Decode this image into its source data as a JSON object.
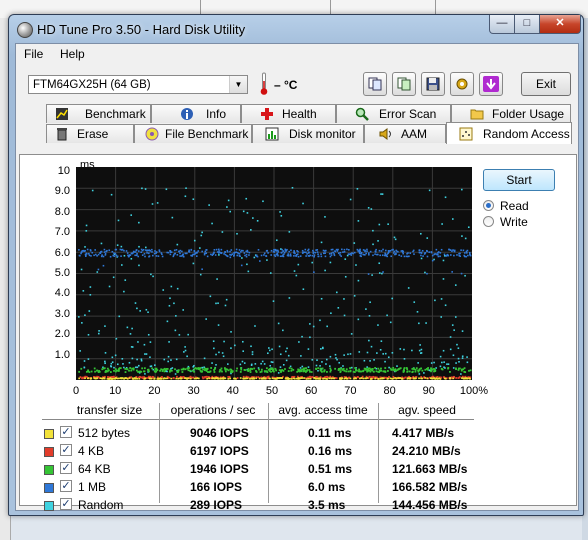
{
  "window": {
    "title": "HD Tune Pro 3.50 - Hard Disk Utility"
  },
  "menu": [
    {
      "label": "File"
    },
    {
      "label": "Help"
    }
  ],
  "toolbar": {
    "drive": "FTM64GX25H (64 GB)",
    "temperature": "– °C",
    "exit_label": "Exit"
  },
  "tabs_row1": [
    {
      "label": "Benchmark",
      "icon": "benchmark-icon"
    },
    {
      "label": "Info",
      "icon": "info-icon"
    },
    {
      "label": "Health",
      "icon": "health-icon"
    },
    {
      "label": "Error Scan",
      "icon": "error-scan-icon"
    },
    {
      "label": "Folder Usage",
      "icon": "folder-icon"
    }
  ],
  "tabs_row2": [
    {
      "label": "Erase",
      "icon": "trash-icon"
    },
    {
      "label": "File Benchmark",
      "icon": "file-benchmark-icon"
    },
    {
      "label": "Disk monitor",
      "icon": "disk-monitor-icon"
    },
    {
      "label": "AAM",
      "icon": "speaker-icon"
    },
    {
      "label": "Random Access",
      "icon": "random-access-icon",
      "active": true
    }
  ],
  "controls": {
    "start_label": "Start",
    "read_label": "Read",
    "write_label": "Write",
    "selected_mode": "Read"
  },
  "chart_data": {
    "type": "scatter",
    "ylabel": "ms",
    "yticks": [
      "10",
      "9.0",
      "8.0",
      "7.0",
      "6.0",
      "5.0",
      "4.0",
      "3.0",
      "2.0",
      "1.0"
    ],
    "xticks": [
      "0",
      "10",
      "20",
      "30",
      "40",
      "50",
      "60",
      "70",
      "80",
      "90",
      "100%"
    ],
    "ylim": [
      0,
      10
    ],
    "xlim": [
      0,
      100
    ],
    "grid": true,
    "series": [
      {
        "name": "512 bytes",
        "color": "#f2e23a",
        "level_ms": 0.11
      },
      {
        "name": "4 KB",
        "color": "#e23c2a",
        "level_ms": 0.16
      },
      {
        "name": "64 KB",
        "color": "#35c435",
        "level_ms": 0.51
      },
      {
        "name": "1 MB",
        "color": "#2f78d8",
        "level_ms": 6.0
      },
      {
        "name": "Random",
        "color": "#3fd2e0",
        "level_ms": 3.5
      }
    ]
  },
  "table": {
    "headers": [
      "transfer size",
      "operations / sec",
      "avg. access time",
      "agv. speed"
    ],
    "rows": [
      {
        "size": "512 bytes",
        "ops": "9046 IOPS",
        "time": "0.11 ms",
        "speed": "4.417 MB/s",
        "color": "#f2e23a",
        "checked": true
      },
      {
        "size": "4 KB",
        "ops": "6197 IOPS",
        "time": "0.16 ms",
        "speed": "24.210 MB/s",
        "color": "#e23c2a",
        "checked": true
      },
      {
        "size": "64 KB",
        "ops": "1946 IOPS",
        "time": "0.51 ms",
        "speed": "121.663 MB/s",
        "color": "#35c435",
        "checked": true
      },
      {
        "size": "1 MB",
        "ops": "166 IOPS",
        "time": "6.0 ms",
        "speed": "166.582 MB/s",
        "color": "#2f78d8",
        "checked": true
      },
      {
        "size": "Random",
        "ops": "289 IOPS",
        "time": "3.5 ms",
        "speed": "144.456 MB/s",
        "color": "#3fd2e0",
        "checked": true
      }
    ]
  }
}
